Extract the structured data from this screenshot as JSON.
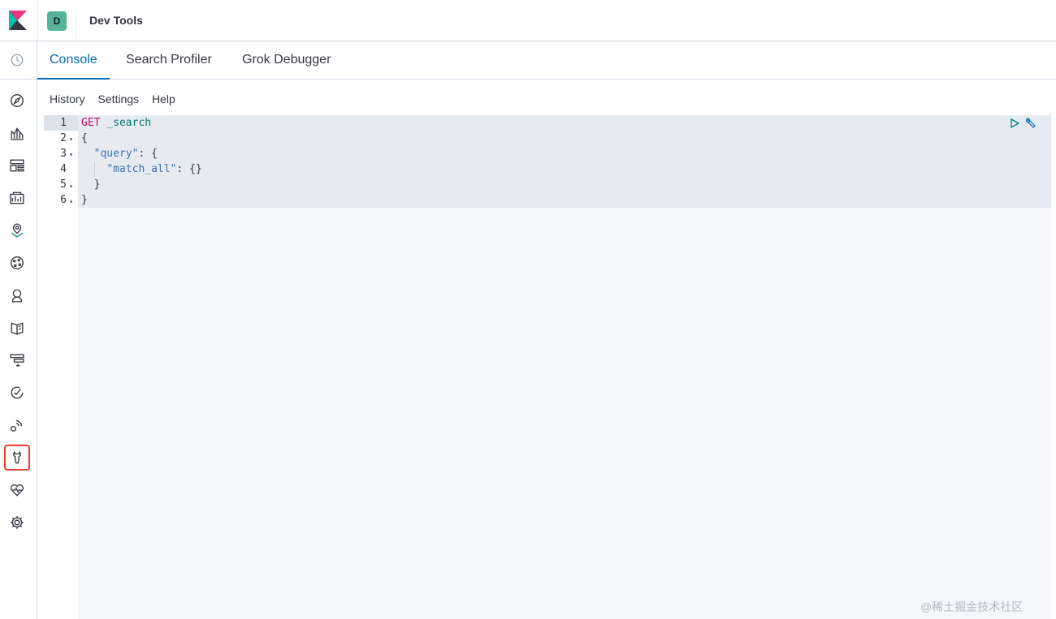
{
  "header": {
    "space_initial": "D",
    "breadcrumb": "Dev Tools",
    "colors": {
      "space_badge": "#54b399",
      "accent": "#006bb4",
      "highlight_border": "#e2402c"
    }
  },
  "sidenav": {
    "items": [
      {
        "name": "recently-viewed-icon"
      },
      {
        "name": "discover-icon"
      },
      {
        "name": "visualize-icon"
      },
      {
        "name": "dashboard-icon"
      },
      {
        "name": "canvas-icon"
      },
      {
        "name": "maps-icon"
      },
      {
        "name": "machine-learning-icon"
      },
      {
        "name": "infrastructure-icon"
      },
      {
        "name": "logs-icon"
      },
      {
        "name": "apm-icon"
      },
      {
        "name": "uptime-icon"
      },
      {
        "name": "siem-icon"
      },
      {
        "name": "dev-tools-icon",
        "active": true
      },
      {
        "name": "stack-monitoring-icon"
      },
      {
        "name": "management-icon"
      }
    ]
  },
  "tabs": [
    {
      "label": "Console",
      "active": true
    },
    {
      "label": "Search Profiler"
    },
    {
      "label": "Grok Debugger"
    }
  ],
  "console_menu": {
    "history": "History",
    "settings": "Settings",
    "help": "Help"
  },
  "editor": {
    "line_numbers": [
      "1",
      "2",
      "3",
      "4",
      "5",
      "6"
    ],
    "lines": [
      {
        "method": "GET",
        "url": "_search"
      },
      {
        "text": "{"
      },
      {
        "key": "\"query\"",
        "rest": ": {"
      },
      {
        "key": "\"match_all\"",
        "rest": ": {}"
      },
      {
        "text": "}"
      },
      {
        "text": "}"
      }
    ]
  },
  "watermark": "@稀土掘金技术社区"
}
